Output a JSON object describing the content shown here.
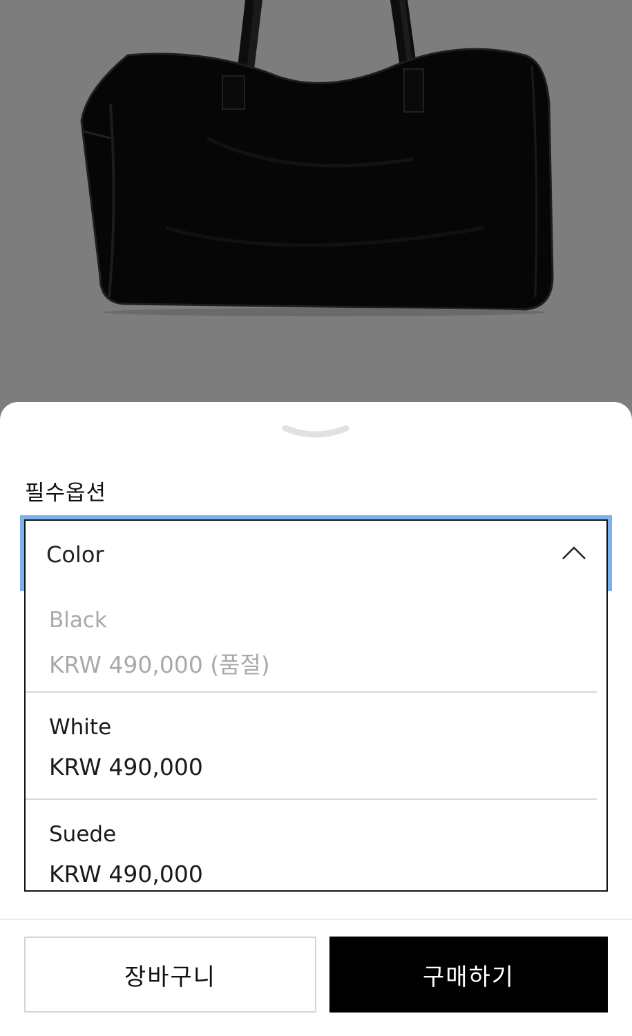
{
  "product": {
    "image_alt": "black-leather-duffel-bag",
    "backdrop_color": "#7d7d7d"
  },
  "sheet": {
    "section_label": "필수옵션",
    "select": {
      "value": "Color",
      "focus_ring_color": "#7fb0ee"
    },
    "options": [
      {
        "name": "Black",
        "price": "KRW 490,000 (품절)",
        "sold_out": true
      },
      {
        "name": "White",
        "price": "KRW 490,000",
        "sold_out": false
      },
      {
        "name": "Suede",
        "price": "KRW 490,000",
        "sold_out": false
      }
    ]
  },
  "actions": {
    "cart_label": "장바구니",
    "buy_label": "구매하기"
  }
}
